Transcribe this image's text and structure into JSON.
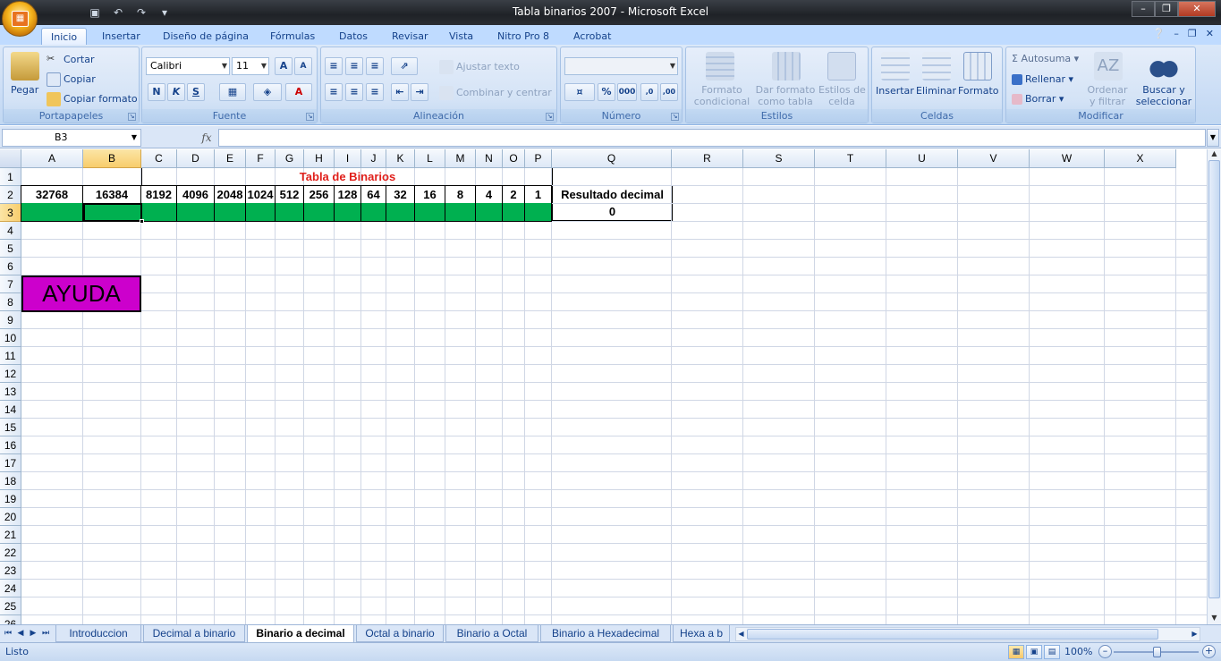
{
  "window": {
    "title": "Tabla binarios 2007  -  Microsoft Excel"
  },
  "ribbon_tabs": [
    "Inicio",
    "Insertar",
    "Diseño de página",
    "Fórmulas",
    "Datos",
    "Revisar",
    "Vista",
    "Nitro Pro 8",
    "Acrobat"
  ],
  "groups": {
    "portapapeles": {
      "label": "Portapapeles",
      "pegar": "Pegar",
      "cortar": "Cortar",
      "copiar": "Copiar",
      "copiar_formato": "Copiar formato"
    },
    "fuente": {
      "label": "Fuente",
      "font": "Calibri",
      "size": "11",
      "bold": "N",
      "italic": "K",
      "underline": "S"
    },
    "alineacion": {
      "label": "Alineación",
      "ajustar": "Ajustar texto",
      "combinar": "Combinar y centrar"
    },
    "numero": {
      "label": "Número"
    },
    "estilos": {
      "label": "Estilos",
      "formato_cond_1": "Formato",
      "formato_cond_2": "condicional",
      "dar_formato_1": "Dar formato",
      "dar_formato_2": "como tabla",
      "estilos_celda_1": "Estilos de",
      "estilos_celda_2": "celda"
    },
    "celdas": {
      "label": "Celdas",
      "insertar": "Insertar",
      "eliminar": "Eliminar",
      "formato": "Formato"
    },
    "modificar": {
      "label": "Modificar",
      "autosuma": "Autosuma",
      "rellenar": "Rellenar",
      "borrar": "Borrar",
      "ordenar_1": "Ordenar",
      "ordenar_2": "y filtrar",
      "buscar_1": "Buscar y",
      "buscar_2": "seleccionar"
    }
  },
  "formula_bar": {
    "name_box": "B3",
    "fx": "fx",
    "formula": ""
  },
  "columns": [
    "A",
    "B",
    "C",
    "D",
    "E",
    "F",
    "G",
    "H",
    "I",
    "J",
    "K",
    "L",
    "M",
    "N",
    "O",
    "P",
    "Q",
    "R",
    "S",
    "T",
    "U",
    "V",
    "W",
    "X"
  ],
  "rows": [
    "1",
    "2",
    "3",
    "4",
    "5",
    "6",
    "7",
    "8",
    "9",
    "10",
    "11",
    "12",
    "13",
    "14",
    "15",
    "16",
    "17",
    "18",
    "19",
    "20",
    "21",
    "22",
    "23",
    "24",
    "25",
    "26"
  ],
  "sheet": {
    "title": "Tabla de Binarios",
    "powers": [
      "32768",
      "16384",
      "8192",
      "4096",
      "2048",
      "1024",
      "512",
      "256",
      "128",
      "64",
      "32",
      "16",
      "8",
      "4",
      "2",
      "1"
    ],
    "result_label": "Resultado decimal",
    "result_value": "0",
    "help_button": "AYUDA"
  },
  "sheet_tabs": [
    "Introduccion",
    "Decimal a binario",
    "Binario a decimal",
    "Octal a binario",
    "Binario a Octal",
    "Binario a Hexadecimal",
    "Hexa a b"
  ],
  "active_sheet": "Binario a decimal",
  "status": {
    "text": "Listo",
    "zoom": "100%"
  },
  "colors": {
    "green_fill": "#00b050",
    "title_red": "#e0201b",
    "help_magenta": "#cc00cc"
  }
}
